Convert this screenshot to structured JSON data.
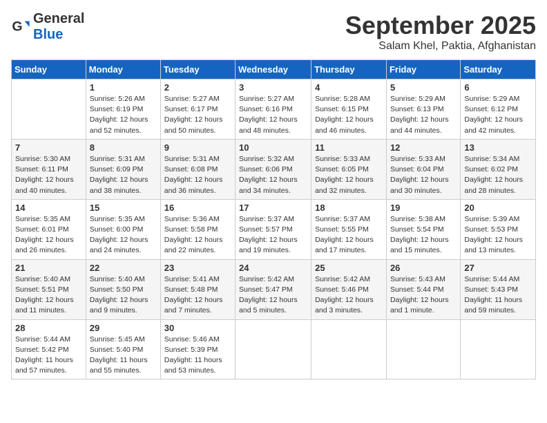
{
  "header": {
    "logo_general": "General",
    "logo_blue": "Blue",
    "month_title": "September 2025",
    "subtitle": "Salam Khel, Paktia, Afghanistan"
  },
  "days_of_week": [
    "Sunday",
    "Monday",
    "Tuesday",
    "Wednesday",
    "Thursday",
    "Friday",
    "Saturday"
  ],
  "weeks": [
    [
      {
        "day": "",
        "content": ""
      },
      {
        "day": "1",
        "content": "Sunrise: 5:26 AM\nSunset: 6:19 PM\nDaylight: 12 hours\nand 52 minutes."
      },
      {
        "day": "2",
        "content": "Sunrise: 5:27 AM\nSunset: 6:17 PM\nDaylight: 12 hours\nand 50 minutes."
      },
      {
        "day": "3",
        "content": "Sunrise: 5:27 AM\nSunset: 6:16 PM\nDaylight: 12 hours\nand 48 minutes."
      },
      {
        "day": "4",
        "content": "Sunrise: 5:28 AM\nSunset: 6:15 PM\nDaylight: 12 hours\nand 46 minutes."
      },
      {
        "day": "5",
        "content": "Sunrise: 5:29 AM\nSunset: 6:13 PM\nDaylight: 12 hours\nand 44 minutes."
      },
      {
        "day": "6",
        "content": "Sunrise: 5:29 AM\nSunset: 6:12 PM\nDaylight: 12 hours\nand 42 minutes."
      }
    ],
    [
      {
        "day": "7",
        "content": "Sunrise: 5:30 AM\nSunset: 6:11 PM\nDaylight: 12 hours\nand 40 minutes."
      },
      {
        "day": "8",
        "content": "Sunrise: 5:31 AM\nSunset: 6:09 PM\nDaylight: 12 hours\nand 38 minutes."
      },
      {
        "day": "9",
        "content": "Sunrise: 5:31 AM\nSunset: 6:08 PM\nDaylight: 12 hours\nand 36 minutes."
      },
      {
        "day": "10",
        "content": "Sunrise: 5:32 AM\nSunset: 6:06 PM\nDaylight: 12 hours\nand 34 minutes."
      },
      {
        "day": "11",
        "content": "Sunrise: 5:33 AM\nSunset: 6:05 PM\nDaylight: 12 hours\nand 32 minutes."
      },
      {
        "day": "12",
        "content": "Sunrise: 5:33 AM\nSunset: 6:04 PM\nDaylight: 12 hours\nand 30 minutes."
      },
      {
        "day": "13",
        "content": "Sunrise: 5:34 AM\nSunset: 6:02 PM\nDaylight: 12 hours\nand 28 minutes."
      }
    ],
    [
      {
        "day": "14",
        "content": "Sunrise: 5:35 AM\nSunset: 6:01 PM\nDaylight: 12 hours\nand 26 minutes."
      },
      {
        "day": "15",
        "content": "Sunrise: 5:35 AM\nSunset: 6:00 PM\nDaylight: 12 hours\nand 24 minutes."
      },
      {
        "day": "16",
        "content": "Sunrise: 5:36 AM\nSunset: 5:58 PM\nDaylight: 12 hours\nand 22 minutes."
      },
      {
        "day": "17",
        "content": "Sunrise: 5:37 AM\nSunset: 5:57 PM\nDaylight: 12 hours\nand 19 minutes."
      },
      {
        "day": "18",
        "content": "Sunrise: 5:37 AM\nSunset: 5:55 PM\nDaylight: 12 hours\nand 17 minutes."
      },
      {
        "day": "19",
        "content": "Sunrise: 5:38 AM\nSunset: 5:54 PM\nDaylight: 12 hours\nand 15 minutes."
      },
      {
        "day": "20",
        "content": "Sunrise: 5:39 AM\nSunset: 5:53 PM\nDaylight: 12 hours\nand 13 minutes."
      }
    ],
    [
      {
        "day": "21",
        "content": "Sunrise: 5:40 AM\nSunset: 5:51 PM\nDaylight: 12 hours\nand 11 minutes."
      },
      {
        "day": "22",
        "content": "Sunrise: 5:40 AM\nSunset: 5:50 PM\nDaylight: 12 hours\nand 9 minutes."
      },
      {
        "day": "23",
        "content": "Sunrise: 5:41 AM\nSunset: 5:48 PM\nDaylight: 12 hours\nand 7 minutes."
      },
      {
        "day": "24",
        "content": "Sunrise: 5:42 AM\nSunset: 5:47 PM\nDaylight: 12 hours\nand 5 minutes."
      },
      {
        "day": "25",
        "content": "Sunrise: 5:42 AM\nSunset: 5:46 PM\nDaylight: 12 hours\nand 3 minutes."
      },
      {
        "day": "26",
        "content": "Sunrise: 5:43 AM\nSunset: 5:44 PM\nDaylight: 12 hours\nand 1 minute."
      },
      {
        "day": "27",
        "content": "Sunrise: 5:44 AM\nSunset: 5:43 PM\nDaylight: 11 hours\nand 59 minutes."
      }
    ],
    [
      {
        "day": "28",
        "content": "Sunrise: 5:44 AM\nSunset: 5:42 PM\nDaylight: 11 hours\nand 57 minutes."
      },
      {
        "day": "29",
        "content": "Sunrise: 5:45 AM\nSunset: 5:40 PM\nDaylight: 11 hours\nand 55 minutes."
      },
      {
        "day": "30",
        "content": "Sunrise: 5:46 AM\nSunset: 5:39 PM\nDaylight: 11 hours\nand 53 minutes."
      },
      {
        "day": "",
        "content": ""
      },
      {
        "day": "",
        "content": ""
      },
      {
        "day": "",
        "content": ""
      },
      {
        "day": "",
        "content": ""
      }
    ]
  ]
}
